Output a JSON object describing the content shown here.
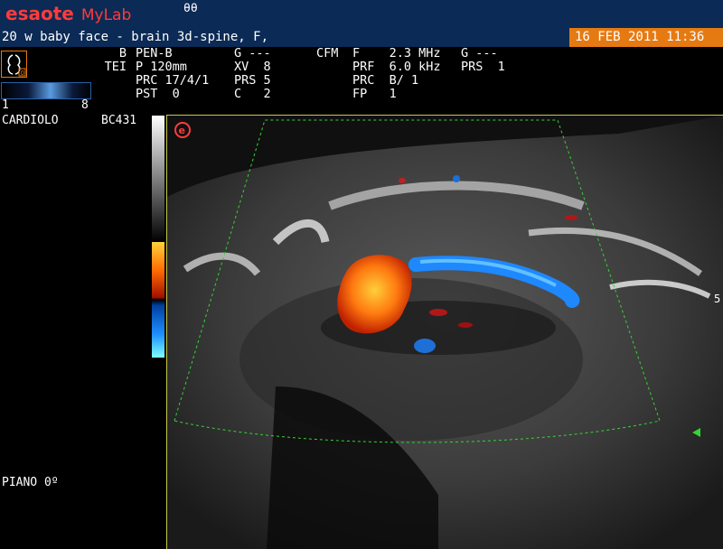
{
  "header": {
    "brand": "esaote",
    "product": "MyLab",
    "mark": "θθ"
  },
  "study": {
    "title": "20 w baby face - brain 3d-spine, F,",
    "date": "16 FEB 2011 11:36"
  },
  "params": {
    "col1": [
      "B",
      "TEI",
      "",
      ""
    ],
    "col2": [
      "PEN-B",
      "P 120mm",
      "PRC 17/4/1",
      "PST  0"
    ],
    "col3": [
      "G ---",
      "XV  8",
      "PRS 5",
      "C   2"
    ],
    "col4": [
      "CFM",
      "",
      "",
      ""
    ],
    "col5": [
      "F    2.3 MHz",
      "PRF  6.0 kHz",
      "PRC  B/ 1",
      "FP   1"
    ],
    "col6": [
      "G ---",
      "",
      "PRS  1",
      ""
    ]
  },
  "scale": {
    "low": "1",
    "high": "8"
  },
  "probe": {
    "name": "CARDIOLO",
    "code": "BC431"
  },
  "plane": "PIANO 0º",
  "side_mark": "5",
  "colors": {
    "header_bg": "#0b2a55",
    "date_bg": "#e67a12",
    "brand_red": "#ff3b3b",
    "roi_green": "#35d335",
    "flow_red": "#ff6a00",
    "flow_blue": "#1e90ff"
  },
  "icons": {
    "probe_icon": "fetus-probe-icon",
    "logo": "esaote-e-icon",
    "marker": "green-triangle-icon"
  }
}
